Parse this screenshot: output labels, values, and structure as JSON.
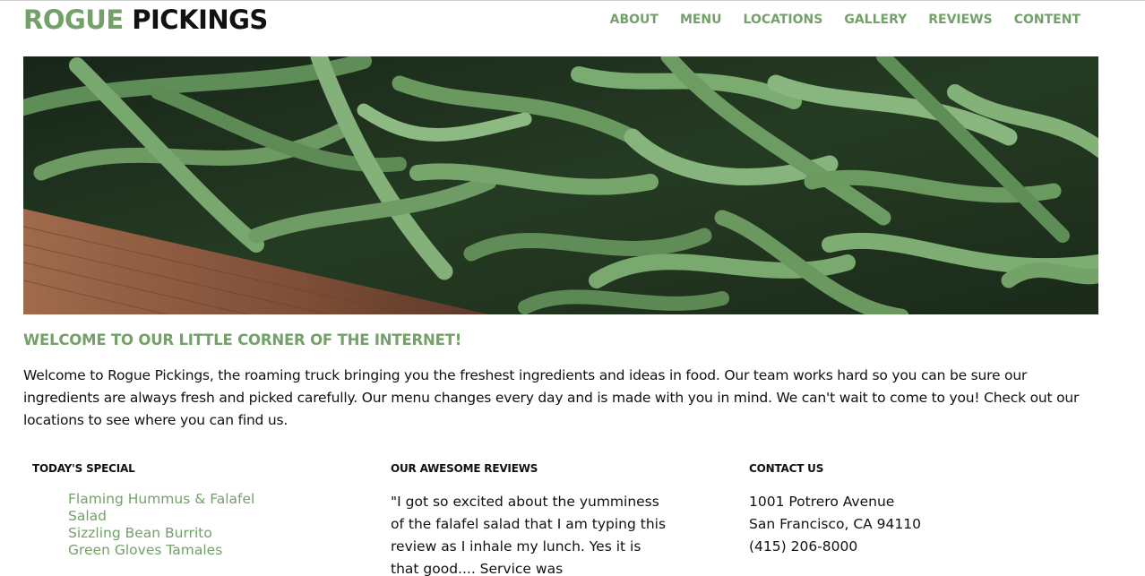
{
  "header": {
    "logo_part1": "ROGUE",
    "logo_part2": "PICKINGS",
    "nav": [
      "ABOUT",
      "MENU",
      "LOCATIONS",
      "GALLERY",
      "REVIEWS",
      "CONTENT"
    ]
  },
  "hero": {
    "image_icon": "green-beans-photo"
  },
  "welcome": {
    "heading": "WELCOME TO OUR LITTLE CORNER OF THE INTERNET!",
    "text": "Welcome to Rogue Pickings, the roaming truck bringing you the freshest ingredients and ideas in food. Our team works hard so you can be sure our ingredients are always fresh and picked carefully. Our menu changes every day and is made with you in mind. We can't wait to come to you! Check out our locations to see where you can find us."
  },
  "special": {
    "title": "TODAY'S SPECIAL",
    "items": [
      "Flaming Hummus & Falafel Salad",
      "Sizzling Bean Burrito",
      "Green Gloves Tamales"
    ]
  },
  "reviews": {
    "title": "OUR AWESOME REVIEWS",
    "text": "\"I got so excited about the yumminess of the falafel salad that I am typing this review as I inhale my lunch. Yes it is that good.... Service was"
  },
  "contact": {
    "title": "CONTACT US",
    "address1": "1001 Potrero Avenue",
    "address2": "San Francisco, CA 94110",
    "phone": "(415) 206-8000"
  },
  "colors": {
    "accent": "#74a06a",
    "text": "#111111",
    "background": "#ffffff"
  }
}
